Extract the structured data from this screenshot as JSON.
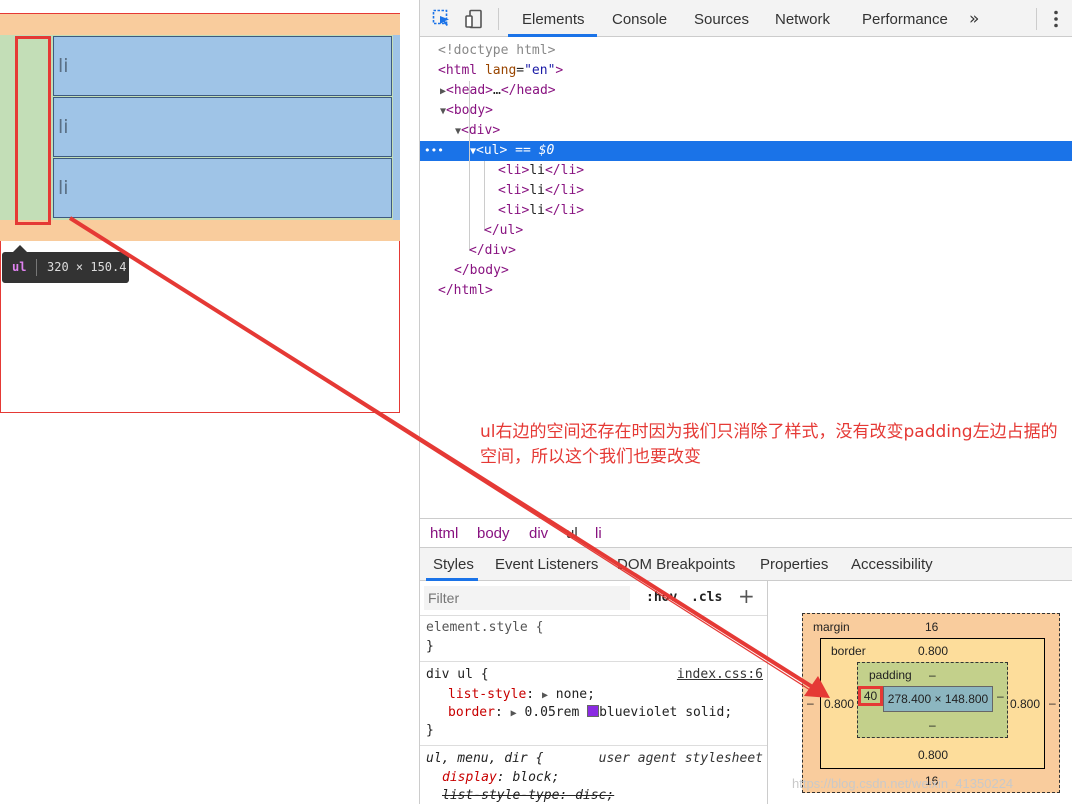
{
  "preview": {
    "li_items": [
      "li",
      "li",
      "li"
    ],
    "tooltip": {
      "tag": "ul",
      "size": "320 × 150.4"
    }
  },
  "toolbar": {
    "tabs": [
      "Elements",
      "Console",
      "Sources",
      "Network",
      "Performance"
    ],
    "active_tab": "Elements",
    "more": "»"
  },
  "dom": {
    "doctype": "<!doctype html>",
    "html_open": "html",
    "lang_attr": "lang",
    "lang_val": "\"en\"",
    "head": "head",
    "head_ellipsis": "…",
    "body": "body",
    "div": "div",
    "ul": "ul",
    "selected_marker": "== $0",
    "li_text": "li",
    "dots": "•••"
  },
  "annotation": "ul右边的空间还存在时因为我们只消除了样式，没有改变padding左边占据的空间，所以这个我们也要改变",
  "breadcrumbs": [
    "html",
    "body",
    "div",
    "ul",
    "li"
  ],
  "styles_tabs": [
    "Styles",
    "Event Listeners",
    "DOM Breakpoints",
    "Properties",
    "Accessibility"
  ],
  "styles": {
    "filter_placeholder": "Filter",
    "hov": ":hov",
    "cls": ".cls",
    "plus": "+",
    "element_style": "element.style {",
    "close": "}",
    "rule1_selector": "div ul {",
    "rule1_source": "index.css:6",
    "rule1_prop1": "list-style",
    "rule1_val1": "none;",
    "rule1_prop2": "border",
    "rule1_val2a": "0.05rem",
    "rule1_val2b": "blueviolet solid;",
    "rule2_selector": "ul, menu, dir {",
    "rule2_source": "user agent stylesheet",
    "rule2_prop1": "display",
    "rule2_val1": "block;",
    "rule2_prop2": "list-style-type",
    "rule2_val2": "disc;"
  },
  "box_model": {
    "margin_label": "margin",
    "margin_top": "16",
    "margin_bottom": "16",
    "margin_left": "–",
    "margin_right": "–",
    "border_label": "border",
    "border_top": "0.800",
    "border_bottom": "0.800",
    "border_left": "0.800",
    "border_right": "0.800",
    "padding_label": "padding",
    "padding_top": "–",
    "padding_bottom": "–",
    "padding_left": "40",
    "padding_right": "–",
    "content": "278.400 × 148.800"
  },
  "watermark": "https://blog.csdn.net/weixin_41350224"
}
